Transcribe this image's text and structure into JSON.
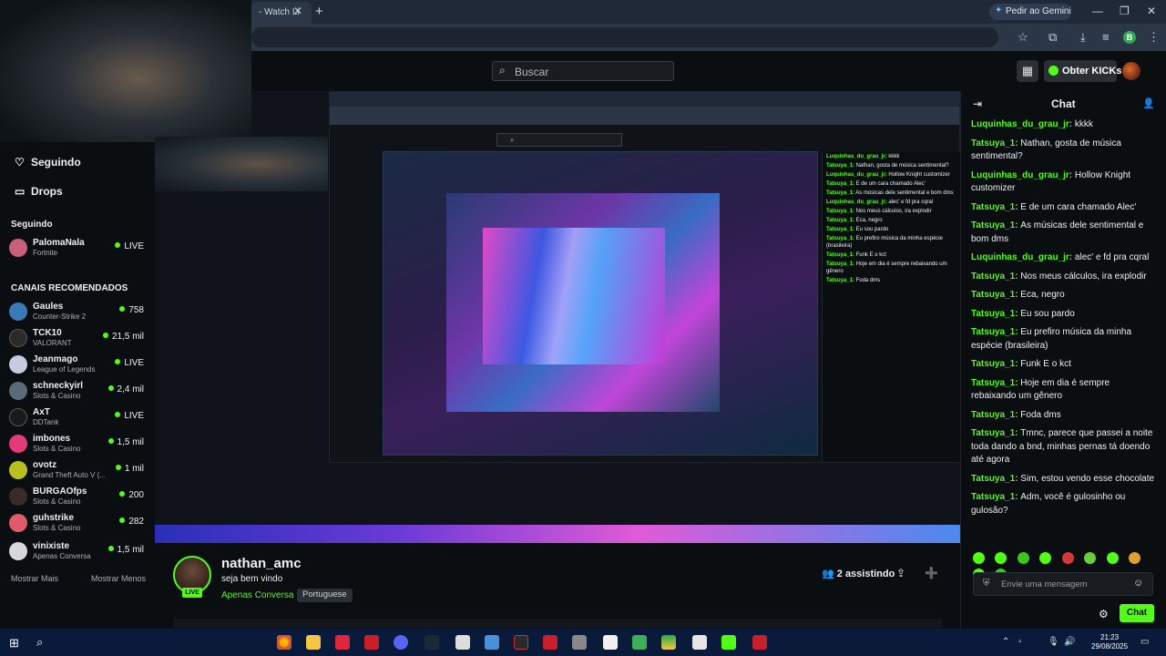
{
  "browser": {
    "tab_title": "- Watch Li",
    "gemini_label": "Pedir ao Gemini",
    "close_glyph": "✕",
    "new_tab_glyph": "+",
    "minimize_glyph": "—",
    "restore_glyph": "❐",
    "profile_letter": "B"
  },
  "header": {
    "search_placeholder": "Buscar",
    "kicks_label": "Obter KICKs"
  },
  "sidebar": {
    "following_label": "Seguindo",
    "drops_label": "Drops",
    "following_section": "Seguindo",
    "followed": [
      {
        "name": "PalomaNala",
        "game": "Fortnite",
        "viewers": "LIVE",
        "color": "#c9607a"
      }
    ],
    "recommended_section": "CANAIS RECOMENDADOS",
    "recommended": [
      {
        "name": "Gaules",
        "game": "Counter-Strike 2",
        "viewers": "758",
        "color": "#3a7ab8"
      },
      {
        "name": "TCK10",
        "game": "VALORANT",
        "viewers": "21,5 mil",
        "color": "#2a2a2a"
      },
      {
        "name": "Jeanmago",
        "game": "League of Legends",
        "viewers": "LIVE",
        "color": "#c7cbe0"
      },
      {
        "name": "schneckyirl",
        "game": "Slots & Casino",
        "viewers": "2,4 mil",
        "color": "#5a6a7a"
      },
      {
        "name": "AxT",
        "game": "DDTank",
        "viewers": "LIVE",
        "color": "#1a1a1a"
      },
      {
        "name": "imbones",
        "game": "Slots & Casino",
        "viewers": "1,5 mil",
        "color": "#e23a7a"
      },
      {
        "name": "ovotz",
        "game": "Grand Theft Auto V (...",
        "viewers": "1 mil",
        "color": "#b8c020"
      },
      {
        "name": "BURGAOfps",
        "game": "Slots & Casino",
        "viewers": "200",
        "color": "#3a2a2a"
      },
      {
        "name": "guhstrike",
        "game": "Slots & Casino",
        "viewers": "282",
        "color": "#e05a6a"
      },
      {
        "name": "vinixiste",
        "game": "Apenas Conversa",
        "viewers": "1,5 mil",
        "color": "#d8d8d8"
      }
    ],
    "show_more": "Mostrar Mais",
    "show_less": "Mostrar Menos"
  },
  "stream": {
    "channel_name": "nathan_amc",
    "title": "seja bem vindo",
    "category": "Apenas Conversa",
    "language": "Portuguese",
    "live_badge": "LIVE",
    "viewers": "2 assistindo"
  },
  "chat": {
    "title": "Chat",
    "input_placeholder": "Envie uma mensagem",
    "send_label": "Chat",
    "messages": [
      {
        "user": "Luquinhas_du_grau_jr",
        "color": "#53fc18",
        "text": "kkkk"
      },
      {
        "user": "Tatsuya_1",
        "color": "#53fc18",
        "text": "Nathan, gosta de música sentimental?"
      },
      {
        "user": "Luquinhas_du_grau_jr",
        "color": "#53fc18",
        "text": "Hollow Knight customizer"
      },
      {
        "user": "Tatsuya_1",
        "color": "#53fc18",
        "text": "E de um cara chamado Alec'"
      },
      {
        "user": "Tatsuya_1",
        "color": "#53fc18",
        "text": "As músicas dele sentimental e bom dms"
      },
      {
        "user": "Luquinhas_du_grau_jr",
        "color": "#53fc18",
        "text": "alec' e fd pra cqral"
      },
      {
        "user": "Tatsuya_1",
        "color": "#53fc18",
        "text": "Nos meus cálculos, ira explodir"
      },
      {
        "user": "Tatsuya_1",
        "color": "#53fc18",
        "text": "Eca, negro"
      },
      {
        "user": "Tatsuya_1",
        "color": "#53fc18",
        "text": "Eu sou pardo"
      },
      {
        "user": "Tatsuya_1",
        "color": "#53fc18",
        "text": "Eu prefiro música da minha espécie (brasileira)"
      },
      {
        "user": "Tatsuya_1",
        "color": "#53fc18",
        "text": "Funk E o kct"
      },
      {
        "user": "Tatsuya_1",
        "color": "#53fc18",
        "text": "Hoje em dia é sempre rebaixando um gênero"
      },
      {
        "user": "Tatsuya_1",
        "color": "#53fc18",
        "text": "Foda dms"
      },
      {
        "user": "Tatsuya_1",
        "color": "#53fc18",
        "text": "Tmnc, parece que passei a noite toda dando a bnd, minhas pernas tá doendo até agora"
      },
      {
        "user": "Tatsuya_1",
        "color": "#53fc18",
        "text": "Sim, estou vendo esse chocolate"
      },
      {
        "user": "Tatsuya_1",
        "color": "#53fc18",
        "text": "Adm, você é gulosinho ou gulosão?"
      }
    ]
  },
  "taskbar": {
    "time": "21:23",
    "date": "29/08/2025"
  },
  "colors": {
    "accent": "#53fc18",
    "background": "#0b0e11"
  }
}
